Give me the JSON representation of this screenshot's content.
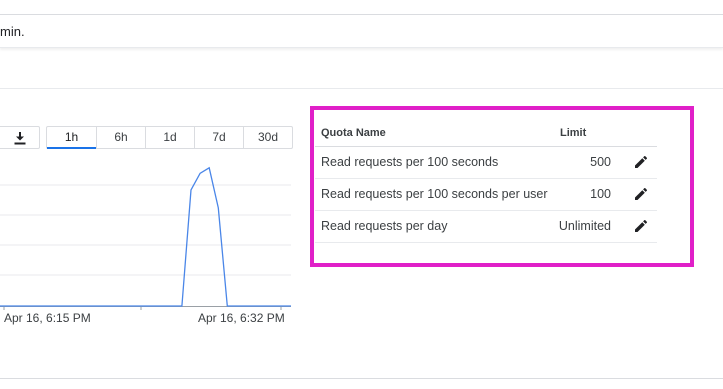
{
  "notice": {
    "text": "min."
  },
  "toolbar": {
    "download_icon": "download-icon",
    "ranges": [
      {
        "label": "1h",
        "active": true
      },
      {
        "label": "6h",
        "active": false
      },
      {
        "label": "1d",
        "active": false
      },
      {
        "label": "7d",
        "active": false
      },
      {
        "label": "30d",
        "active": false
      }
    ]
  },
  "chart_data": {
    "type": "line",
    "title": "",
    "xlabel": "",
    "ylabel": "",
    "grid": true,
    "x_tick_labels": [
      "Apr 16, 6:15 PM",
      "Apr 16, 6:32 PM"
    ],
    "series": [
      {
        "color": "#4a86e8",
        "x": [
          0,
          4,
          8,
          12,
          16,
          20,
          24,
          28,
          32,
          36,
          40,
          42,
          44,
          46,
          48,
          50,
          52,
          56,
          60,
          64
        ],
        "values": [
          0,
          0,
          0,
          0,
          0,
          0,
          0,
          0,
          0,
          0,
          0,
          0.84,
          0.96,
          1.0,
          0.71,
          0,
          0,
          0,
          0,
          0
        ]
      }
    ],
    "ylim": [
      0,
      1.1
    ]
  },
  "quota": {
    "header": {
      "name": "Quota Name",
      "limit": "Limit"
    },
    "rows": [
      {
        "name": "Read requests per 100 seconds",
        "limit": "500"
      },
      {
        "name": "Read requests per 100 seconds per user",
        "limit": "100"
      },
      {
        "name": "Read requests per day",
        "limit": "Unlimited"
      }
    ],
    "edit_icon": "pencil-icon",
    "highlight_color": "#e020c8"
  }
}
